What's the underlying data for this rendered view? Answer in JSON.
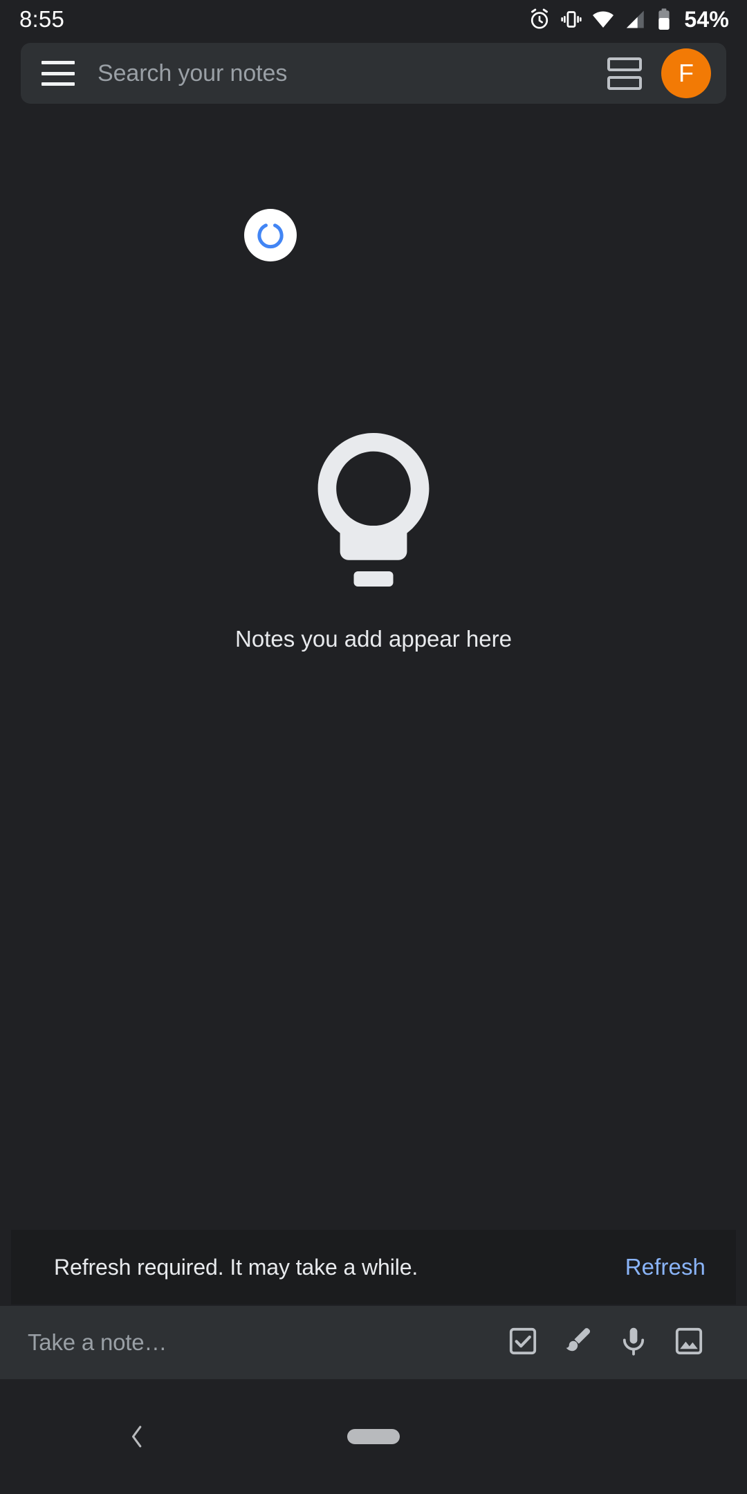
{
  "status_bar": {
    "clock": "8:55",
    "battery_percent": "54%",
    "icons": [
      "alarm-icon",
      "vibrate-icon",
      "wifi-icon",
      "cell-signal-icon",
      "battery-icon"
    ]
  },
  "search_bar": {
    "menu_icon": "hamburger-menu-icon",
    "placeholder": "Search your notes",
    "value": "",
    "view_toggle_icon": "list-view-toggle-icon",
    "avatar_initial": "F",
    "avatar_color": "#f27a05"
  },
  "sync": {
    "spinner_icon": "sync-spinner-icon",
    "spinner_color": "#4285f4",
    "spinner_background": "#ffffff"
  },
  "empty_state": {
    "icon": "lightbulb-icon",
    "message": "Notes you add appear here"
  },
  "snackbar": {
    "message": "Refresh required. It may take a while.",
    "action_label": "Refresh",
    "action_color": "#8ab4f8"
  },
  "note_bar": {
    "placeholder": "Take a note…",
    "actions": [
      {
        "icon": "checkbox-list-icon",
        "name": "new-list-button"
      },
      {
        "icon": "brush-icon",
        "name": "new-drawing-button"
      },
      {
        "icon": "microphone-icon",
        "name": "new-voice-note-button"
      },
      {
        "icon": "image-icon",
        "name": "new-image-note-button"
      }
    ]
  },
  "nav_bar": {
    "back_icon": "back-chevron-icon",
    "home_icon": "home-pill-icon"
  }
}
